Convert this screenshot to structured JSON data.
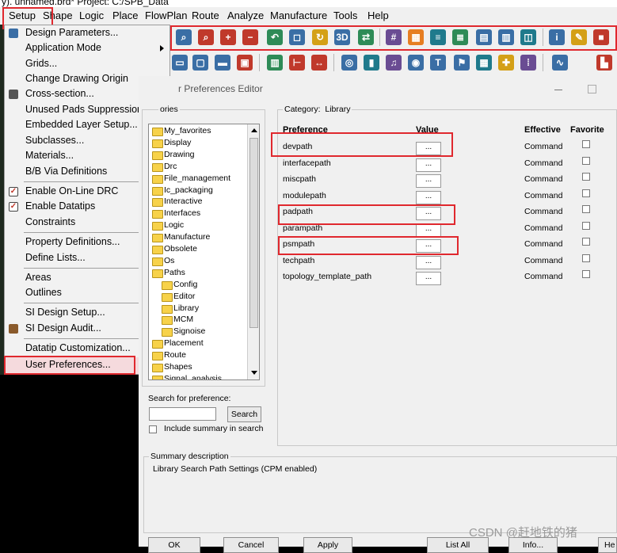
{
  "window": {
    "title": "y). unnamed.brd* Project: C:/SPB_Data"
  },
  "menubar": [
    "Setup",
    "Shape",
    "Logic",
    "Place",
    "FlowPlan",
    "Route",
    "Analyze",
    "Manufacture",
    "Tools",
    "Help"
  ],
  "setup_menu": [
    {
      "label": "Design Parameters...",
      "icon": "design-params-icon"
    },
    {
      "label": "Application Mode",
      "submenu": true
    },
    {
      "label": "Grids..."
    },
    {
      "label": "Change Drawing Origin"
    },
    {
      "label": "Cross-section...",
      "icon": "cross-section-icon"
    },
    {
      "label": "Unused Pads Suppression..."
    },
    {
      "label": "Embedded Layer Setup..."
    },
    {
      "label": "Subclasses..."
    },
    {
      "label": "Materials..."
    },
    {
      "label": "B/B Via Definitions",
      "submenu": true
    },
    {
      "label": "Enable On-Line DRC",
      "checked": true
    },
    {
      "label": "Enable Datatips",
      "checked": true
    },
    {
      "label": "Constraints",
      "submenu": true
    },
    {
      "label": "Property Definitions..."
    },
    {
      "label": "Define Lists..."
    },
    {
      "label": "Areas",
      "submenu": true
    },
    {
      "label": "Outlines",
      "submenu": true
    },
    {
      "label": "SI Design Setup..."
    },
    {
      "label": "SI Design Audit...",
      "icon": "si-audit-icon"
    },
    {
      "label": "Datatip Customization..."
    },
    {
      "label": "User Preferences..."
    }
  ],
  "dialog": {
    "title": "r Preferences Editor",
    "categories_label": "ories",
    "category_label": "Category:",
    "category_value": "Library",
    "tree": [
      {
        "label": "My_favorites",
        "indent": 0
      },
      {
        "label": "Display",
        "indent": 0
      },
      {
        "label": "Drawing",
        "indent": 0
      },
      {
        "label": "Drc",
        "indent": 0
      },
      {
        "label": "File_management",
        "indent": 0
      },
      {
        "label": "Ic_packaging",
        "indent": 0
      },
      {
        "label": "Interactive",
        "indent": 0
      },
      {
        "label": "Interfaces",
        "indent": 0
      },
      {
        "label": "Logic",
        "indent": 0
      },
      {
        "label": "Manufacture",
        "indent": 0
      },
      {
        "label": "Obsolete",
        "indent": 0
      },
      {
        "label": "Os",
        "indent": 0
      },
      {
        "label": "Paths",
        "indent": 0
      },
      {
        "label": "Config",
        "indent": 1
      },
      {
        "label": "Editor",
        "indent": 1
      },
      {
        "label": "Library",
        "indent": 1
      },
      {
        "label": "MCM",
        "indent": 1
      },
      {
        "label": "Signoise",
        "indent": 1
      },
      {
        "label": "Placement",
        "indent": 0
      },
      {
        "label": "Route",
        "indent": 0
      },
      {
        "label": "Shapes",
        "indent": 0
      },
      {
        "label": "Signal_analysis",
        "indent": 0
      }
    ],
    "headers": {
      "preference": "Preference",
      "value": "Value",
      "effective": "Effective",
      "favorite": "Favorite"
    },
    "prefs": [
      {
        "name": "devpath",
        "value": "...",
        "effective": "Command"
      },
      {
        "name": "interfacepath",
        "value": "...",
        "effective": "Command"
      },
      {
        "name": "miscpath",
        "value": "...",
        "effective": "Command"
      },
      {
        "name": "modulepath",
        "value": "...",
        "effective": "Command"
      },
      {
        "name": "padpath",
        "value": "...",
        "effective": "Command"
      },
      {
        "name": "parampath",
        "value": "...",
        "effective": "Command"
      },
      {
        "name": "psmpath",
        "value": "...",
        "effective": "Command"
      },
      {
        "name": "techpath",
        "value": "...",
        "effective": "Command"
      },
      {
        "name": "topology_template_path",
        "value": "...",
        "effective": "Command"
      }
    ],
    "search_label": "Search for preference:",
    "search_value": "",
    "search_button": "Search",
    "include_summary": "Include summary in search",
    "summary_title": "Summary description",
    "summary_text": "Library Search Path Settings (CPM enabled)",
    "buttons": [
      "OK",
      "Cancel",
      "Apply",
      "List All",
      "Info...",
      "He"
    ]
  },
  "watermark": "CSDN @赶地铁的猪",
  "toolbar_colors": [
    "#3a6ea5",
    "#c0392b",
    "#2e8b57",
    "#d4a017",
    "#6a4c93",
    "#e67e22",
    "#1f7a8c"
  ]
}
